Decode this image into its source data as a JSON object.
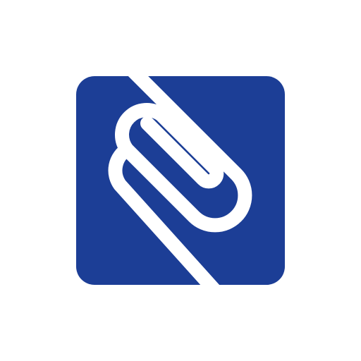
{
  "app_icon": {
    "icon": "paperclip-icon",
    "colors": {
      "tile": "#1c3e96",
      "clip": "#ffffff",
      "background": "#ffffff"
    }
  }
}
